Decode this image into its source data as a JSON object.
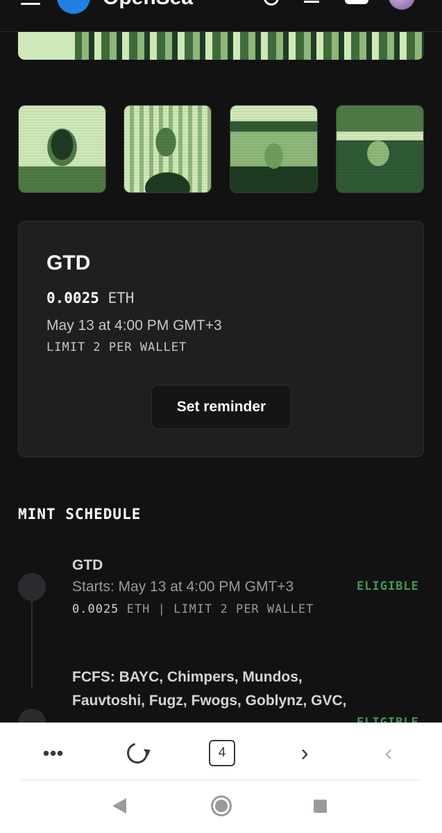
{
  "header": {
    "logo_text": "OpenSea"
  },
  "collection": {
    "thumbnails": [
      "pixel-art-1",
      "pixel-art-2",
      "pixel-art-3",
      "pixel-art-4"
    ]
  },
  "gtd_card": {
    "title": "GTD",
    "price_value": "0.0025",
    "price_unit": "ETH",
    "date": "May 13 at 4:00 PM GMT+3",
    "limit": "LIMIT 2 PER WALLET",
    "reminder_label": "Set reminder"
  },
  "mint_schedule": {
    "title": "MINT SCHEDULE",
    "phases": [
      {
        "name": "GTD",
        "starts": "Starts: May 13 at 4:00 PM GMT+3",
        "price_value": "0.0025",
        "price_rest": "ETH | LIMIT 2 PER WALLET",
        "status": "ELIGIBLE"
      },
      {
        "name": "FCFS: BAYC, Chimpers, Mundos, Fauvtoshi, Fugz, Fwogs, Goblynz, GVC,",
        "status": "ELIGIBLE"
      }
    ]
  },
  "browser_bar": {
    "more_label": "•••",
    "tab_count": "4",
    "forward_label": "›",
    "back_label": "‹"
  },
  "colors": {
    "background": "#121212",
    "card": "#1e1f21",
    "eligible": "#3f9a5a"
  }
}
